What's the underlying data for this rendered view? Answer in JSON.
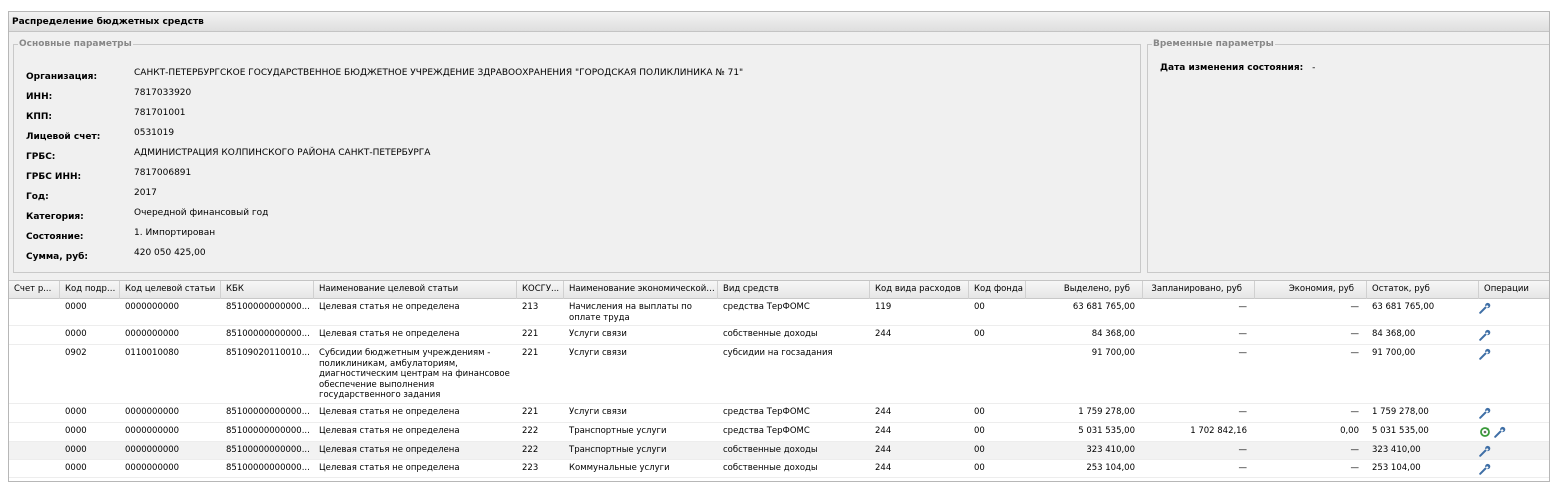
{
  "panel": {
    "title": "Распределение бюджетных средств",
    "main_legend": "Основные параметры",
    "time_legend": "Временные параметры"
  },
  "params": [
    {
      "label": "Организация:",
      "value": "САНКТ-ПЕТЕРБУРГСКОЕ ГОСУДАРСТВЕННОЕ БЮДЖЕТНОЕ УЧРЕЖДЕНИЕ ЗДРАВООХРАНЕНИЯ \"ГОРОДСКАЯ ПОЛИКЛИНИКА № 71\""
    },
    {
      "label": "ИНН:",
      "value": "7817033920"
    },
    {
      "label": "КПП:",
      "value": "781701001"
    },
    {
      "label": "Лицевой счет:",
      "value": "0531019"
    },
    {
      "label": "ГРБС:",
      "value": "АДМИНИСТРАЦИЯ КОЛПИНСКОГО РАЙОНА САНКТ-ПЕТЕРБУРГА"
    },
    {
      "label": "ГРБС ИНН:",
      "value": "7817006891"
    },
    {
      "label": "Год:",
      "value": "2017"
    },
    {
      "label": "Категория:",
      "value": "Очередной финансовый год"
    },
    {
      "label": "Состояние:",
      "value": "1. Импортирован"
    },
    {
      "label": "Сумма, руб:",
      "value": "420 050 425,00"
    }
  ],
  "time_params": {
    "label": "Дата изменения состояния:",
    "value": "-"
  },
  "columns": [
    "Счет р...",
    "Код подра...",
    "Код целевой статьи",
    "КБК",
    "Наименование целевой статьи",
    "КОСГУ...",
    "Наименование экономической ...",
    "Вид средств",
    "Код вида расходов",
    "Код фонда",
    "Выделено, руб",
    "Запланировано, руб",
    "Экономия, руб",
    "Остаток, руб",
    "Операции"
  ],
  "rows": [
    {
      "schet": "",
      "podr": "0000",
      "cel": "0000000000",
      "kbk": "85100000000000...",
      "naim_cel": "Целевая статья не определена",
      "kosgu": "213",
      "naim_ek": "Начисления на выплаты по оплате труда",
      "vid": "средства ТерФОМС",
      "kvr": "119",
      "fond": "00",
      "vydeleno": "63 681 765,00",
      "zapl": "—",
      "ekon": "—",
      "ostatok": "63 681 765,00",
      "icons": [
        "wrench-icon"
      ]
    },
    {
      "schet": "",
      "podr": "0000",
      "cel": "0000000000",
      "kbk": "85100000000000...",
      "naim_cel": "Целевая статья не определена",
      "kosgu": "221",
      "naim_ek": "Услуги связи",
      "vid": "собственные доходы",
      "kvr": "244",
      "fond": "00",
      "vydeleno": "84 368,00",
      "zapl": "—",
      "ekon": "—",
      "ostatok": "84 368,00",
      "icons": [
        "wrench-icon"
      ]
    },
    {
      "schet": "",
      "podr": "0902",
      "cel": "0110010080",
      "kbk": "85109020110010...",
      "naim_cel": "Субсидии бюджетным учреждениям - поликлиникам, амбулаториям, диагностическим центрам на финансовое обеспечение выполнения государственного задания",
      "kosgu": "221",
      "naim_ek": "Услуги связи",
      "vid": "субсидии на госзадания",
      "kvr": "",
      "fond": "",
      "vydeleno": "91 700,00",
      "zapl": "—",
      "ekon": "—",
      "ostatok": "91 700,00",
      "icons": [
        "wrench-icon"
      ]
    },
    {
      "schet": "",
      "podr": "0000",
      "cel": "0000000000",
      "kbk": "85100000000000...",
      "naim_cel": "Целевая статья не определена",
      "kosgu": "221",
      "naim_ek": "Услуги связи",
      "vid": "средства ТерФОМС",
      "kvr": "244",
      "fond": "00",
      "vydeleno": "1 759 278,00",
      "zapl": "—",
      "ekon": "—",
      "ostatok": "1 759 278,00",
      "icons": [
        "wrench-icon"
      ]
    },
    {
      "schet": "",
      "podr": "0000",
      "cel": "0000000000",
      "kbk": "85100000000000...",
      "naim_cel": "Целевая статья не определена",
      "kosgu": "222",
      "naim_ek": "Транспортные услуги",
      "vid": "средства ТерФОМС",
      "kvr": "244",
      "fond": "00",
      "vydeleno": "5 031 535,00",
      "zapl": "1 702 842,16",
      "ekon": "0,00",
      "ostatok": "5 031 535,00",
      "icons": [
        "refresh-icon",
        "wrench-icon"
      ]
    },
    {
      "schet": "",
      "podr": "0000",
      "cel": "0000000000",
      "kbk": "85100000000000...",
      "naim_cel": "Целевая статья не определена",
      "kosgu": "222",
      "naim_ek": "Транспортные услуги",
      "vid": "собственные доходы",
      "kvr": "244",
      "fond": "00",
      "vydeleno": "323 410,00",
      "zapl": "—",
      "ekon": "—",
      "ostatok": "323 410,00",
      "icons": [
        "wrench-icon"
      ]
    },
    {
      "schet": "",
      "podr": "0000",
      "cel": "0000000000",
      "kbk": "85100000000000...",
      "naim_cel": "Целевая статья не определена",
      "kosgu": "223",
      "naim_ek": "Коммунальные услуги",
      "vid": "собственные доходы",
      "kvr": "244",
      "fond": "00",
      "vydeleno": "253 104,00",
      "zapl": "—",
      "ekon": "—",
      "ostatok": "253 104,00",
      "icons": [
        "wrench-icon"
      ]
    }
  ]
}
